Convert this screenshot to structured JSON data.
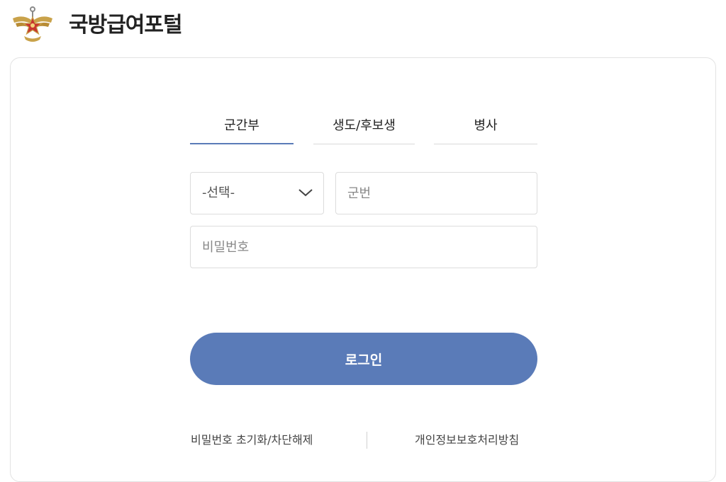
{
  "header": {
    "logo_icon": "military-emblem-icon",
    "title": "국방급여포털"
  },
  "tabs": [
    {
      "label": "군간부",
      "active": true
    },
    {
      "label": "생도/후보생",
      "active": false
    },
    {
      "label": "병사",
      "active": false
    }
  ],
  "form": {
    "category_select": {
      "selected": "-선택-",
      "icon": "chevron-down-icon"
    },
    "service_number": {
      "placeholder": "군번",
      "value": ""
    },
    "password": {
      "placeholder": "비밀번호",
      "value": ""
    },
    "login_label": "로그인"
  },
  "footer": {
    "reset_link": "비밀번호 초기화/차단해제",
    "privacy_link": "개인정보보호처리방침"
  },
  "colors": {
    "accent": "#5a7bb8",
    "border": "#dcdcdc",
    "logo_gold": "#c9a24a",
    "logo_red": "#c8362f"
  }
}
